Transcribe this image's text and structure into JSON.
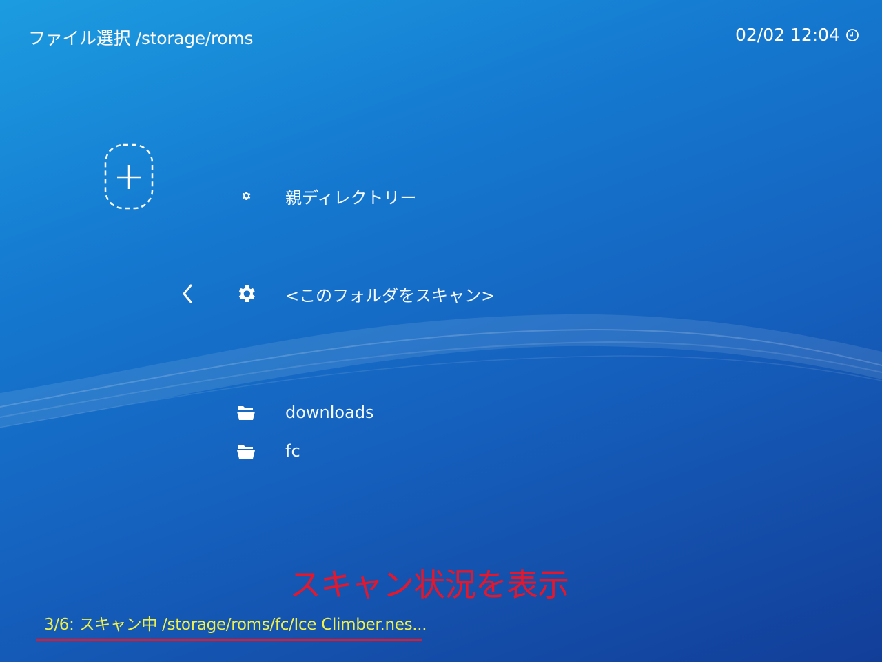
{
  "header": {
    "title": "ファイル選択 /storage/roms",
    "clock": "02/02 12:04",
    "clock_icon": "clock-icon"
  },
  "sidebar": {
    "add_icon": "plus-icon"
  },
  "file_list": {
    "items": [
      {
        "label": "親ディレクトリー",
        "icon": "gear-icon"
      },
      {
        "label": "<このフォルダをスキャン>",
        "icon": "gear-icon",
        "selected": true
      },
      {
        "label": "downloads",
        "icon": "folder-icon"
      },
      {
        "label": "fc",
        "icon": "folder-icon"
      }
    ]
  },
  "status": {
    "text": "3/6: スキャン中 /storage/roms/fc/Ice Climber.nes..."
  },
  "annotation": {
    "text": "スキャン状況を表示",
    "color": "#e8162a"
  },
  "colors": {
    "status_text": "#f0f04a",
    "background_top": "#1c9ce0",
    "background_bottom": "#123e98"
  }
}
